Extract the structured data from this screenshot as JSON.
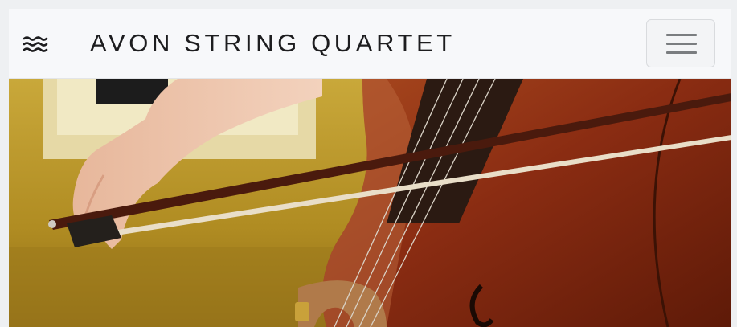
{
  "navbar": {
    "brand_icon": "waves-icon",
    "brand_title": "AVON STRING QUARTET",
    "toggler_icon": "hamburger-menu-icon"
  },
  "hero": {
    "image_subject": "cello-bow-photo"
  },
  "colors": {
    "navbar_bg": "#f7f8fa",
    "brand_text": "#1d1d1f",
    "cello_wood": "#8a2c12",
    "wall": "#b89a2c"
  }
}
